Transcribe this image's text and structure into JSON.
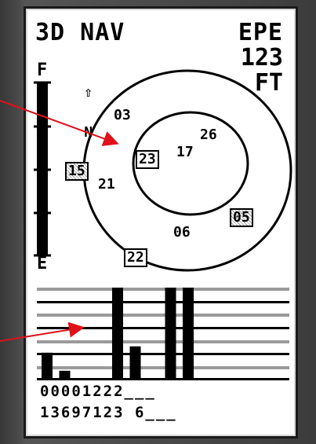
{
  "header": {
    "mode": "3D NAV",
    "epe_label": "EPE",
    "epe_value": "123",
    "epe_unit": "FT"
  },
  "accuracy_gauge": {
    "top_label": "F",
    "bottom_label": "E"
  },
  "north_indicator": {
    "glyph": "⇧",
    "label": "N"
  },
  "sky_view": {
    "satellites": [
      {
        "prn": "03",
        "boxed": false
      },
      {
        "prn": "26",
        "boxed": false
      },
      {
        "prn": "17",
        "boxed": false
      },
      {
        "prn": "23",
        "boxed": true
      },
      {
        "prn": "21",
        "boxed": false
      },
      {
        "prn": "15",
        "boxed": true
      },
      {
        "prn": "05",
        "boxed": true
      },
      {
        "prn": "06",
        "boxed": false
      },
      {
        "prn": "22",
        "boxed": true
      }
    ]
  },
  "signal_bars": {
    "prn_tens": "00001222___",
    "prn_ones": "13697123 6___",
    "strength": [
      0.28,
      0.08,
      0.0,
      0.0,
      1.0,
      0.35,
      0.0,
      1.0,
      1.0,
      0.0,
      0.0
    ],
    "colors": {
      "bar": "#000000",
      "grid": "#000000",
      "band": "#9a9a9a"
    }
  },
  "annotations": {
    "arrow_color": "#e0101a"
  }
}
